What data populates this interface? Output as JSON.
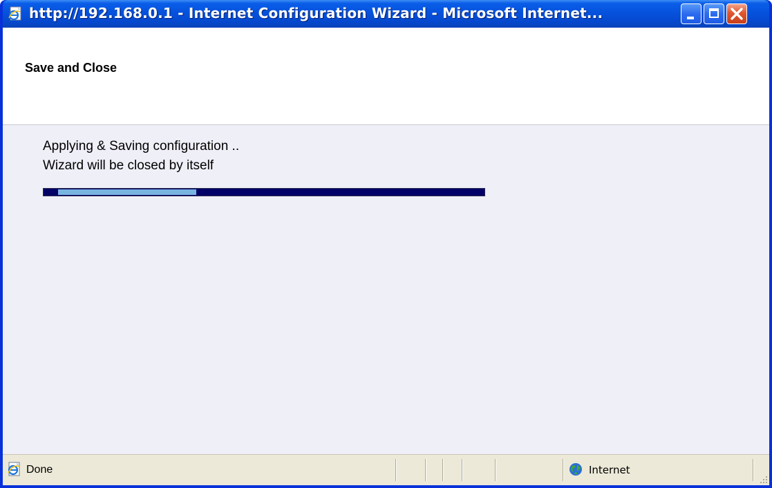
{
  "window": {
    "title": "http://192.168.0.1 - Internet Configuration Wizard - Microsoft Internet...",
    "title_icon": "ie-page-icon",
    "buttons": {
      "minimize": "minimize-icon",
      "maximize": "maximize-icon",
      "close": "close-icon"
    }
  },
  "wizard": {
    "heading": "Save and Close",
    "message_line1": "Applying & Saving configuration ..",
    "message_line2": "Wizard will be closed by itself",
    "progress": {
      "segment_start_fraction": 0.033,
      "segment_end_fraction": 0.347,
      "track_color": "#000066",
      "fill_color": "#78B4E0"
    }
  },
  "statusbar": {
    "status_text": "Done",
    "status_icon": "ie-page-icon",
    "zone_text": "Internet",
    "zone_icon": "globe-icon"
  }
}
